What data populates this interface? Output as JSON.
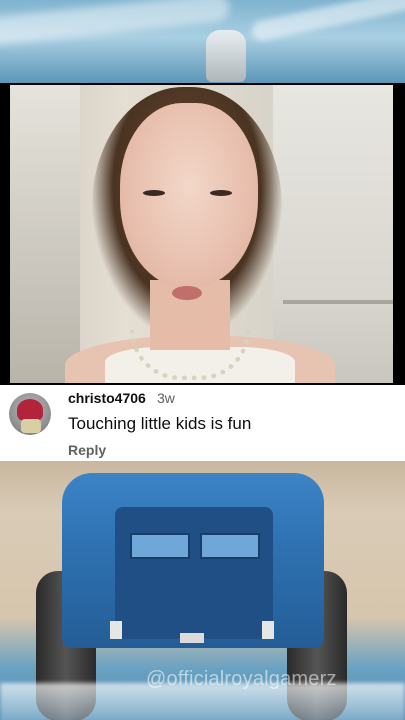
{
  "comment": {
    "username": "christo4706",
    "time": "3w",
    "text": "Touching little kids is fun",
    "reply_label": "Reply"
  },
  "watermark": "@officialroyalgamerz",
  "colors": {
    "comment_background": "#ffffff",
    "username_color": "#0f0f0f",
    "secondary_text": "#606060",
    "truck_blue": "#2f72b3"
  },
  "icons": {
    "avatar": "user-avatar"
  }
}
